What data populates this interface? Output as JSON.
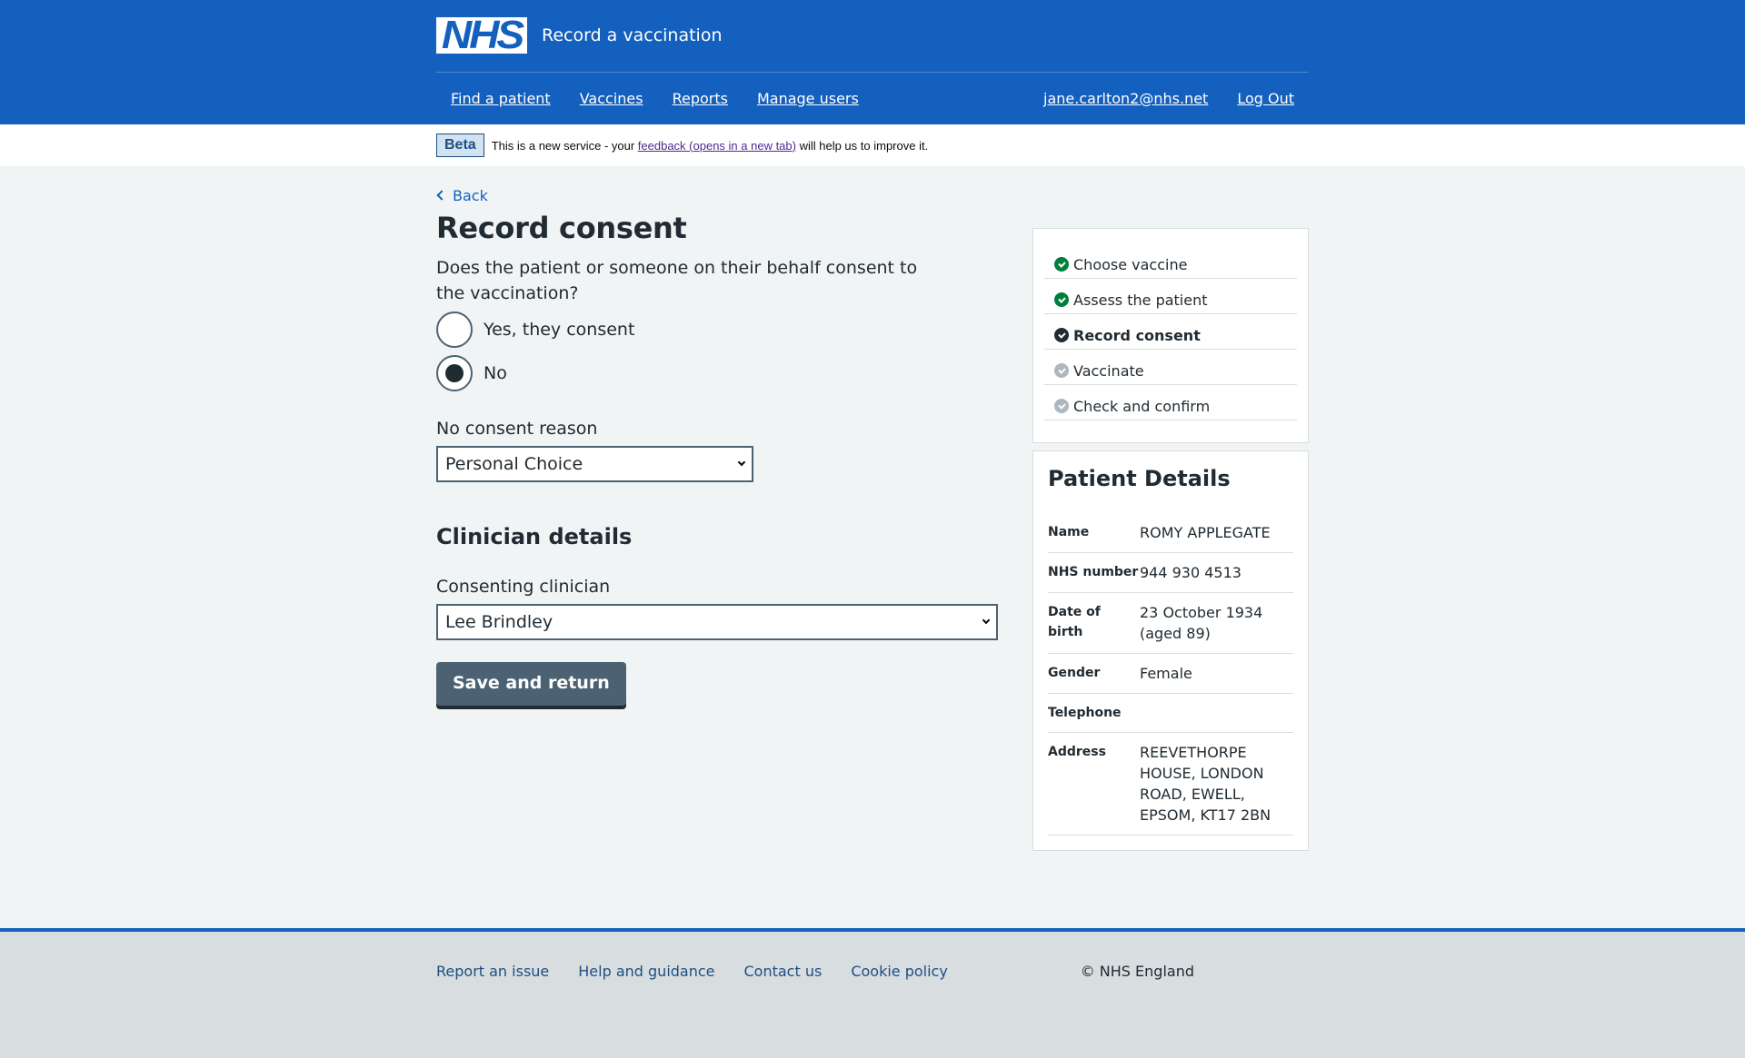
{
  "header": {
    "logo_text": "NHS",
    "service_name": "Record a vaccination",
    "nav": [
      {
        "label": "Find a patient"
      },
      {
        "label": "Vaccines"
      },
      {
        "label": "Reports"
      },
      {
        "label": "Manage users"
      }
    ],
    "user_email": "jane.carlton2@nhs.net",
    "logout_label": "Log Out"
  },
  "beta_banner": {
    "tag": "Beta",
    "text_before": "This is a new service - your ",
    "link_text": "feedback (opens in a new tab)",
    "text_after": " will help us to improve it."
  },
  "main": {
    "back_label": "Back",
    "title": "Record consent",
    "question": "Does the patient or someone on their behalf consent to the vaccination?",
    "radios": [
      {
        "label": "Yes, they consent",
        "checked": false
      },
      {
        "label": "No",
        "checked": true
      }
    ],
    "no_consent_reason": {
      "label": "No consent reason",
      "selected": "Personal Choice"
    },
    "clinician_heading": "Clinician details",
    "consenting_clinician": {
      "label": "Consenting clinician",
      "selected": "Lee Brindley"
    },
    "save_button": "Save and return"
  },
  "steps": [
    {
      "label": "Choose vaccine",
      "status": "done",
      "icon": "check-circle-icon"
    },
    {
      "label": "Assess the patient",
      "status": "done",
      "icon": "check-circle-icon"
    },
    {
      "label": "Record consent",
      "status": "current",
      "icon": "check-circle-icon"
    },
    {
      "label": "Vaccinate",
      "status": "todo",
      "icon": "check-circle-icon"
    },
    {
      "label": "Check and confirm",
      "status": "todo",
      "icon": "check-circle-icon"
    }
  ],
  "patient_details": {
    "title": "Patient Details",
    "rows": [
      {
        "key": "Name",
        "value": "ROMY APPLEGATE"
      },
      {
        "key": "NHS number",
        "value": "944 930 4513"
      },
      {
        "key": "Date of birth",
        "value": "23 October 1934 (aged 89)"
      },
      {
        "key": "Gender",
        "value": "Female"
      },
      {
        "key": "Telephone",
        "value": ""
      },
      {
        "key": "Address",
        "value": "REEVETHORPE HOUSE, LONDON ROAD, EWELL, EPSOM, KT17 2BN"
      }
    ]
  },
  "footer": {
    "links": [
      {
        "label": "Report an issue"
      },
      {
        "label": "Help and guidance"
      },
      {
        "label": "Contact us"
      },
      {
        "label": "Cookie policy"
      }
    ],
    "copyright": "© NHS England"
  },
  "colors": {
    "brand_blue": "#1460be",
    "text": "#212b32",
    "page_bg": "#f0f4f5",
    "success_green": "#007f3b",
    "secondary_button": "#4c6272"
  }
}
